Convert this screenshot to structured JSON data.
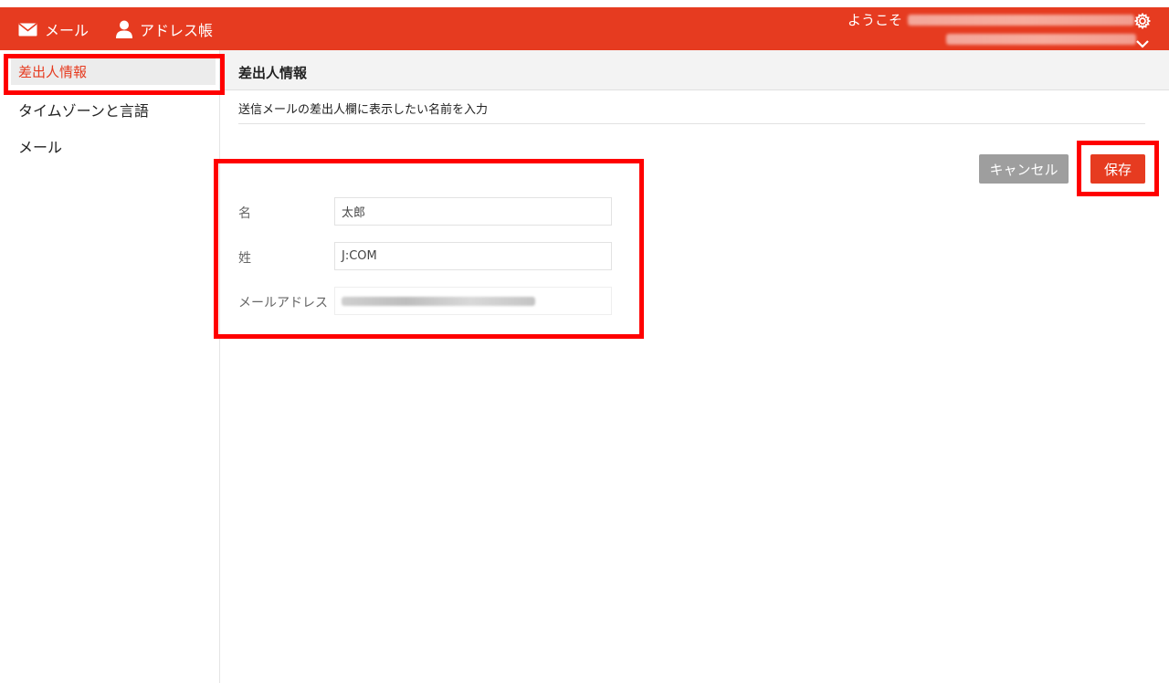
{
  "header": {
    "nav_mail_label": "メール",
    "nav_address_label": "アドレス帳",
    "welcome_label": "ようこそ",
    "accent_color": "#e63b20"
  },
  "sidebar": {
    "items": [
      {
        "label": "差出人情報",
        "active": true
      },
      {
        "label": "タイムゾーンと言語",
        "active": false
      },
      {
        "label": "メール",
        "active": false
      }
    ]
  },
  "panel": {
    "title": "差出人情報",
    "description": "送信メールの差出人欄に表示したい名前を入力",
    "buttons": {
      "cancel": "キャンセル",
      "save": "保存"
    },
    "fields": {
      "first_name": {
        "label": "名",
        "value": "太郎"
      },
      "last_name": {
        "label": "姓",
        "value": "J:COM"
      },
      "email": {
        "label": "メールアドレス"
      }
    }
  },
  "icons": [
    "mail-icon",
    "person-icon",
    "gear-icon",
    "chevron-down-icon"
  ],
  "highlight_color": "#ff0000"
}
